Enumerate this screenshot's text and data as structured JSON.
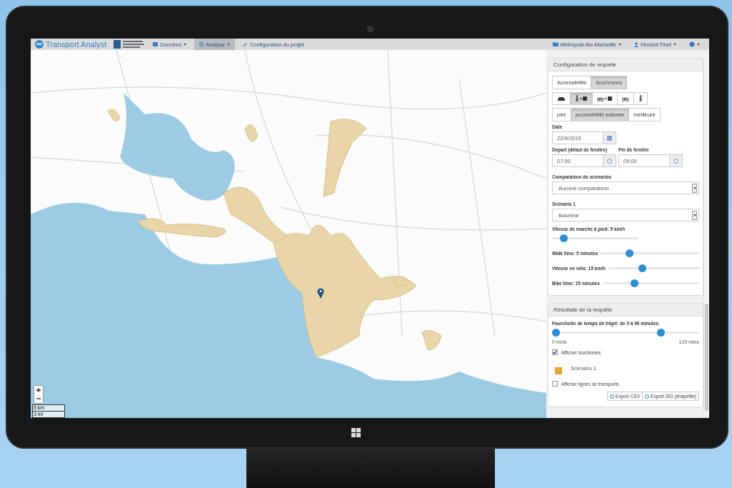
{
  "navbar": {
    "brand": "Transport Analyst",
    "menus": [
      {
        "label": "Données",
        "selected": false,
        "kind": "data"
      },
      {
        "label": "Analyse",
        "selected": true,
        "kind": "analysis"
      },
      {
        "label": "Configuration du projet",
        "selected": false,
        "kind": "config"
      }
    ],
    "right_menus": [
      {
        "label": "Métropole Aix-Marseille",
        "kind": "folder"
      },
      {
        "label": "Vincent Tinet",
        "kind": "user"
      }
    ]
  },
  "map": {
    "scale": [
      "5 km",
      "3 mi"
    ]
  },
  "query_panel": {
    "title": "Configuration de requête",
    "tabs": [
      {
        "label": "Accessibilité",
        "selected": false
      },
      {
        "label": "Isochrones",
        "selected": true
      }
    ],
    "modes": [
      {
        "kind": "car",
        "selected": false
      },
      {
        "kind": "walk-transit",
        "selected": true
      },
      {
        "kind": "bike-transit",
        "selected": false
      },
      {
        "kind": "bike",
        "selected": false
      },
      {
        "kind": "walk",
        "selected": false
      }
    ],
    "estimates": [
      {
        "label": "pire",
        "selected": false
      },
      {
        "label": "accessibilité estimée",
        "selected": true
      },
      {
        "label": "meilleure",
        "selected": false
      }
    ],
    "date": {
      "label": "Date",
      "value": "22/9/2015"
    },
    "times": [
      {
        "label": "Départ (début de fenêtre)",
        "value": "07:00"
      },
      {
        "label": "Fin de fenêtre",
        "value": "09:00"
      }
    ],
    "selects": [
      {
        "label": "Comparaison de scénarios",
        "value": "Aucune comparaison"
      },
      {
        "label": "Scénario 1",
        "value": "Baseline"
      }
    ],
    "sliders": [
      {
        "kind": "stacked",
        "label": "Vitesse de marche à pied: 5 km/h",
        "level": 0.1
      },
      {
        "kind": "inline",
        "label": "Walk time: 5 minutes",
        "level": 0.27
      },
      {
        "kind": "inline",
        "label": "Vitesse en vélo: 15 km/h",
        "level": 0.36
      },
      {
        "kind": "inline",
        "label": "Bike time: 20 minutes",
        "level": 0.31
      }
    ]
  },
  "results_panel": {
    "title": "Résultats de la requête",
    "range": {
      "label": "Fourchette de temps de trajet: de 0 à 90 minutes",
      "handles": [
        {
          "level": 0
        },
        {
          "level": 0.75
        }
      ],
      "min": "0 mins",
      "max": "120 mins"
    },
    "show_isochrones": {
      "label": "Afficher isochrones",
      "checked": true
    },
    "legend": [
      {
        "label": "Scénario 1",
        "color": "#e0a93a"
      }
    ],
    "show_lines": {
      "label": "Afficher lignes de transports",
      "checked": false
    },
    "buttons": [
      "Export CSV",
      "Export SIG (shapefile)"
    ]
  }
}
